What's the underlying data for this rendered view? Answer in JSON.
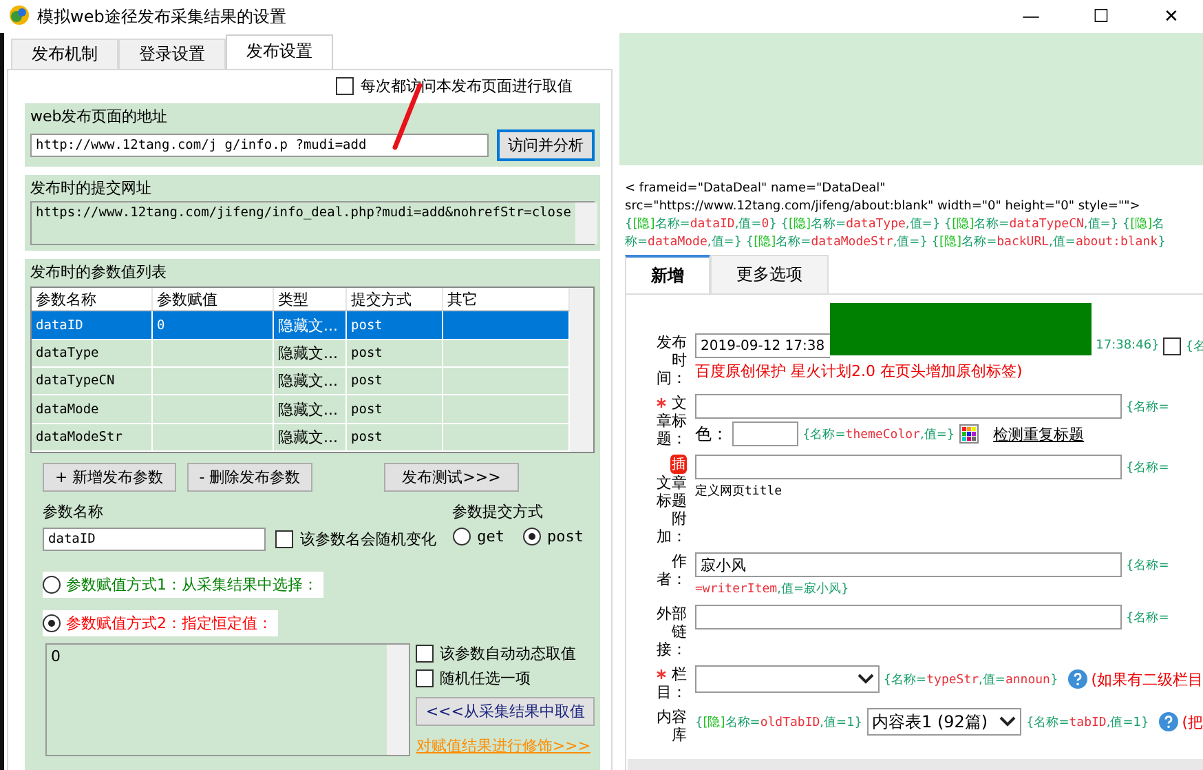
{
  "window": {
    "title": "模拟web途径发布采集结果的设置",
    "controls": [
      "—",
      "☐",
      "✕"
    ]
  },
  "tabs": [
    {
      "label": "发布机制",
      "selected": false
    },
    {
      "label": "登录设置",
      "selected": false
    },
    {
      "label": "发布设置",
      "selected": true
    }
  ],
  "visit_each_time": {
    "label": "每次都访问本发布页面进行取值",
    "checked": false
  },
  "page_url": {
    "title": "web发布页面的地址",
    "value": "http://www.12tang.com/j    g/info.p    ?mudi=add",
    "button": "访问并分析"
  },
  "submit_url": {
    "title": "发布时的提交网址",
    "value": "https://www.12tang.com/jifeng/info_deal.php?mudi=add&nohrefStr=close"
  },
  "params": {
    "title": "发布时的参数值列表",
    "columns": [
      "参数名称",
      "参数赋值",
      "类型",
      "提交方式",
      "其它"
    ],
    "rows": [
      {
        "cells": [
          "dataID",
          "0",
          "隐藏文...",
          "post",
          ""
        ],
        "selected": true
      },
      {
        "cells": [
          "dataType",
          "",
          "隐藏文...",
          "post",
          ""
        ],
        "selected": false
      },
      {
        "cells": [
          "dataTypeCN",
          "",
          "隐藏文...",
          "post",
          ""
        ],
        "selected": false
      },
      {
        "cells": [
          "dataMode",
          "",
          "隐藏文...",
          "post",
          ""
        ],
        "selected": false
      },
      {
        "cells": [
          "dataModeStr",
          "",
          "隐藏文...",
          "post",
          ""
        ],
        "selected": false
      }
    ],
    "buttons": [
      "+ 新增发布参数",
      "- 删除发布参数",
      "发布测试>>>"
    ]
  },
  "param_name": {
    "title": "参数名称",
    "value": "dataID",
    "random_label": "该参数名会随机变化",
    "random_checked": false
  },
  "submit_method": {
    "title": "参数提交方式",
    "options": [
      {
        "label": "get",
        "selected": false
      },
      {
        "label": "post",
        "selected": true
      }
    ]
  },
  "assign_modes": [
    {
      "label": "参数赋值方式1：从采集结果中选择：",
      "selected": false,
      "color": "#008000"
    },
    {
      "label": "参数赋值方式2：指定恒定值：",
      "selected": true,
      "color": "#ff0000"
    }
  ],
  "constant_value": "0",
  "value_options": [
    {
      "label": "该参数自动动态取值",
      "checked": false
    },
    {
      "label": "随机任选一项",
      "checked": false
    }
  ],
  "take_button": "<<<从采集结果中取值",
  "fix_link": "对赋值结果进行修饰>>>",
  "preview": {
    "code_lines": [
      [
        {
          "kind": "plain",
          "text": "< frameid=\"DataDeal\" name=\"DataDeal\""
        }
      ],
      [
        {
          "kind": "plain",
          "text": "src=\"https://www.12tang.com/jifeng/about:blank\" width=\"0\" height=\"0\" style=\"\">"
        }
      ],
      [
        {
          "kind": "key",
          "text": "{"
        },
        {
          "kind": "hidden",
          "text": "[隐]"
        },
        {
          "kind": "key",
          "text": "名称="
        },
        {
          "kind": "value",
          "text": "dataID"
        },
        {
          "kind": "key",
          "text": ",值="
        },
        {
          "kind": "value",
          "text": "0"
        },
        {
          "kind": "key",
          "text": "} {"
        },
        {
          "kind": "hidden",
          "text": "[隐]"
        },
        {
          "kind": "key",
          "text": "名称="
        },
        {
          "kind": "value",
          "text": "dataType"
        },
        {
          "kind": "key",
          "text": ",值=} {"
        },
        {
          "kind": "hidden",
          "text": "[隐]"
        },
        {
          "kind": "key",
          "text": "名称="
        },
        {
          "kind": "value",
          "text": "dataTypeCN"
        },
        {
          "kind": "key",
          "text": ",值=} {"
        },
        {
          "kind": "hidden",
          "text": "[隐]"
        },
        {
          "kind": "key",
          "text": "名"
        }
      ],
      [
        {
          "kind": "key",
          "text": "称="
        },
        {
          "kind": "value",
          "text": "dataMode"
        },
        {
          "kind": "key",
          "text": ",值=} {"
        },
        {
          "kind": "hidden",
          "text": "[隐]"
        },
        {
          "kind": "key",
          "text": "名称="
        },
        {
          "kind": "value",
          "text": "dataModeStr"
        },
        {
          "kind": "key",
          "text": ",值=} {"
        },
        {
          "kind": "hidden",
          "text": "[隐]"
        },
        {
          "kind": "key",
          "text": "名称="
        },
        {
          "kind": "value",
          "text": "backURL"
        },
        {
          "kind": "key",
          "text": ",值="
        },
        {
          "kind": "value",
          "text": "about:blank"
        },
        {
          "kind": "key",
          "text": "}"
        }
      ]
    ],
    "tabs": [
      {
        "label": "新增",
        "selected": true
      },
      {
        "label": "更多选项",
        "selected": false
      }
    ],
    "fields": [
      {
        "kind": "date",
        "label": "发布时间：",
        "value": "2019-09-12 17:38",
        "hint": [
          {
            "kind": "key",
            "text": "17:38:46}"
          }
        ],
        "tail": [
          {
            "kind": "key",
            "text": "{名"
          }
        ],
        "checked": false,
        "note": "百度原创保护 星火计划2.0 在页头增加原创标签)"
      },
      {
        "kind": "title",
        "label": "文章标题：",
        "required": true,
        "hint": [
          {
            "kind": "key",
            "text": "{名称="
          }
        ],
        "color_label": "色：",
        "color_hint": [
          {
            "kind": "key",
            "text": "{名称="
          },
          {
            "kind": "value",
            "text": "themeColor"
          },
          {
            "kind": "key",
            "text": ",值=}"
          }
        ],
        "link": "检测重复标题"
      },
      {
        "kind": "text",
        "badge": "插",
        "label": "文章标题附加：",
        "hint": [
          {
            "kind": "key",
            "text": "{名称="
          }
        ],
        "below": [
          {
            "kind": "plain",
            "text": "定义网页"
          },
          {
            "kind": "mono",
            "text": "title"
          }
        ]
      },
      {
        "kind": "text",
        "label": "作者：",
        "value": "寂小风",
        "hint": [
          {
            "kind": "key",
            "text": "{名称="
          }
        ],
        "below": [
          {
            "kind": "value",
            "text": "=writerItem"
          },
          {
            "kind": "key",
            "text": ",值=寂小风}"
          }
        ]
      },
      {
        "kind": "text",
        "label": "外部链接：",
        "hint": [
          {
            "kind": "key",
            "text": "{名称="
          }
        ]
      },
      {
        "kind": "select",
        "label": "栏目：",
        "required": true,
        "hint": [
          {
            "kind": "key",
            "text": "{名称="
          },
          {
            "kind": "value",
            "text": "typeStr"
          },
          {
            "kind": "key",
            "text": ",值="
          },
          {
            "kind": "value",
            "text": "announ"
          },
          {
            "kind": "key",
            "text": "}"
          }
        ],
        "note": "(如果有二级栏目"
      },
      {
        "kind": "library",
        "label": "内容库",
        "pre": [
          {
            "kind": "key",
            "text": "{"
          },
          {
            "kind": "hidden",
            "text": "[隐]"
          },
          {
            "kind": "key",
            "text": "名称="
          },
          {
            "kind": "value",
            "text": "oldTabID"
          },
          {
            "kind": "key",
            "text": ",值=1}"
          }
        ],
        "value": "内容表1 (92篇)",
        "hint": [
          {
            "kind": "key",
            "text": "{名称="
          },
          {
            "kind": "value",
            "text": "tabID"
          },
          {
            "kind": "key",
            "text": ",值=1}"
          }
        ],
        "note": "(把"
      }
    ]
  }
}
